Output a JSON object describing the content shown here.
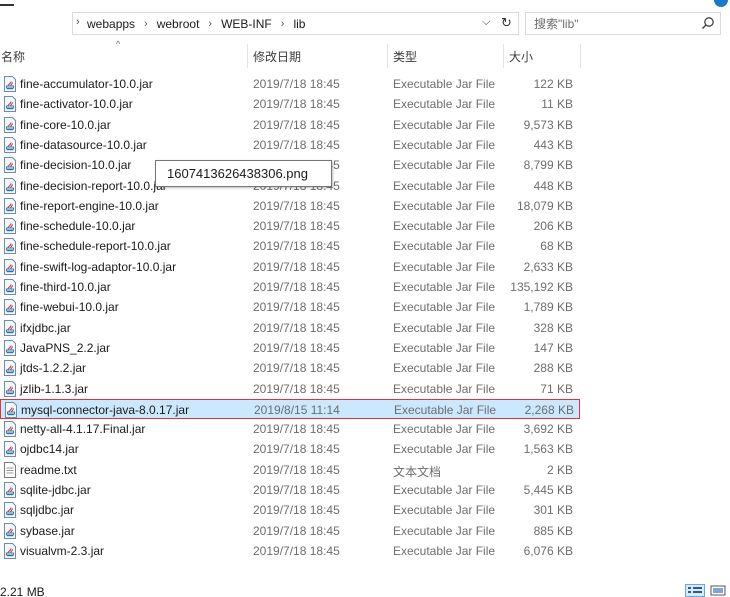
{
  "address": {
    "crumbs": [
      "webapps",
      "webroot",
      "WEB-INF",
      "lib"
    ],
    "separator": "›"
  },
  "search": {
    "placeholder": "搜索\"lib\""
  },
  "columns": {
    "name": "名称",
    "date": "修改日期",
    "type": "类型",
    "size": "大小"
  },
  "files": [
    {
      "name": "fine-accumulator-10.0.jar",
      "date": "2019/7/18 18:45",
      "type": "Executable Jar File",
      "size": "122 KB",
      "icon": "jar-file-icon"
    },
    {
      "name": "fine-activator-10.0.jar",
      "date": "2019/7/18 18:45",
      "type": "Executable Jar File",
      "size": "11 KB",
      "icon": "jar-file-icon"
    },
    {
      "name": "fine-core-10.0.jar",
      "date": "2019/7/18 18:45",
      "type": "Executable Jar File",
      "size": "9,573 KB",
      "icon": "jar-file-icon"
    },
    {
      "name": "fine-datasource-10.0.jar",
      "date": "2019/7/18 18:45",
      "type": "Executable Jar File",
      "size": "443 KB",
      "icon": "jar-file-icon"
    },
    {
      "name": "fine-decision-10.0.jar",
      "date": "2019/7/18 18:45",
      "type": "Executable Jar File",
      "size": "8,799 KB",
      "icon": "jar-file-icon"
    },
    {
      "name": "fine-decision-report-10.0.jar",
      "date": "2019/7/18 18:45",
      "type": "Executable Jar File",
      "size": "448 KB",
      "icon": "jar-file-icon"
    },
    {
      "name": "fine-report-engine-10.0.jar",
      "date": "2019/7/18 18:45",
      "type": "Executable Jar File",
      "size": "18,079 KB",
      "icon": "jar-file-icon"
    },
    {
      "name": "fine-schedule-10.0.jar",
      "date": "2019/7/18 18:45",
      "type": "Executable Jar File",
      "size": "206 KB",
      "icon": "jar-file-icon"
    },
    {
      "name": "fine-schedule-report-10.0.jar",
      "date": "2019/7/18 18:45",
      "type": "Executable Jar File",
      "size": "68 KB",
      "icon": "jar-file-icon"
    },
    {
      "name": "fine-swift-log-adaptor-10.0.jar",
      "date": "2019/7/18 18:45",
      "type": "Executable Jar File",
      "size": "2,633 KB",
      "icon": "jar-file-icon"
    },
    {
      "name": "fine-third-10.0.jar",
      "date": "2019/7/18 18:45",
      "type": "Executable Jar File",
      "size": "135,192 KB",
      "icon": "jar-file-icon"
    },
    {
      "name": "fine-webui-10.0.jar",
      "date": "2019/7/18 18:45",
      "type": "Executable Jar File",
      "size": "1,789 KB",
      "icon": "jar-file-icon"
    },
    {
      "name": "ifxjdbc.jar",
      "date": "2019/7/18 18:45",
      "type": "Executable Jar File",
      "size": "328 KB",
      "icon": "jar-file-icon"
    },
    {
      "name": "JavaPNS_2.2.jar",
      "date": "2019/7/18 18:45",
      "type": "Executable Jar File",
      "size": "147 KB",
      "icon": "jar-file-icon"
    },
    {
      "name": "jtds-1.2.2.jar",
      "date": "2019/7/18 18:45",
      "type": "Executable Jar File",
      "size": "288 KB",
      "icon": "jar-file-icon"
    },
    {
      "name": "jzlib-1.1.3.jar",
      "date": "2019/7/18 18:45",
      "type": "Executable Jar File",
      "size": "71 KB",
      "icon": "jar-file-icon"
    },
    {
      "name": "mysql-connector-java-8.0.17.jar",
      "date": "2019/8/15 11:14",
      "type": "Executable Jar File",
      "size": "2,268 KB",
      "icon": "jar-file-icon",
      "selected": true
    },
    {
      "name": "netty-all-4.1.17.Final.jar",
      "date": "2019/7/18 18:45",
      "type": "Executable Jar File",
      "size": "3,692 KB",
      "icon": "jar-file-icon"
    },
    {
      "name": "ojdbc14.jar",
      "date": "2019/7/18 18:45",
      "type": "Executable Jar File",
      "size": "1,563 KB",
      "icon": "jar-file-icon"
    },
    {
      "name": "readme.txt",
      "date": "2019/7/18 18:45",
      "type": "文本文档",
      "size": "2 KB",
      "icon": "text-file-icon"
    },
    {
      "name": "sqlite-jdbc.jar",
      "date": "2019/7/18 18:45",
      "type": "Executable Jar File",
      "size": "5,445 KB",
      "icon": "jar-file-icon"
    },
    {
      "name": "sqljdbc.jar",
      "date": "2019/7/18 18:45",
      "type": "Executable Jar File",
      "size": "301 KB",
      "icon": "jar-file-icon"
    },
    {
      "name": "sybase.jar",
      "date": "2019/7/18 18:45",
      "type": "Executable Jar File",
      "size": "885 KB",
      "icon": "jar-file-icon"
    },
    {
      "name": "visualvm-2.3.jar",
      "date": "2019/7/18 18:45",
      "type": "Executable Jar File",
      "size": "6,076 KB",
      "icon": "jar-file-icon"
    }
  ],
  "tooltip": {
    "text": "1607413626438306.png"
  },
  "status": {
    "selection_size": "2.21 MB"
  },
  "colors": {
    "selection_bg": "#cce8ff",
    "selection_border": "#e0343c",
    "accent": "#1979ca"
  }
}
